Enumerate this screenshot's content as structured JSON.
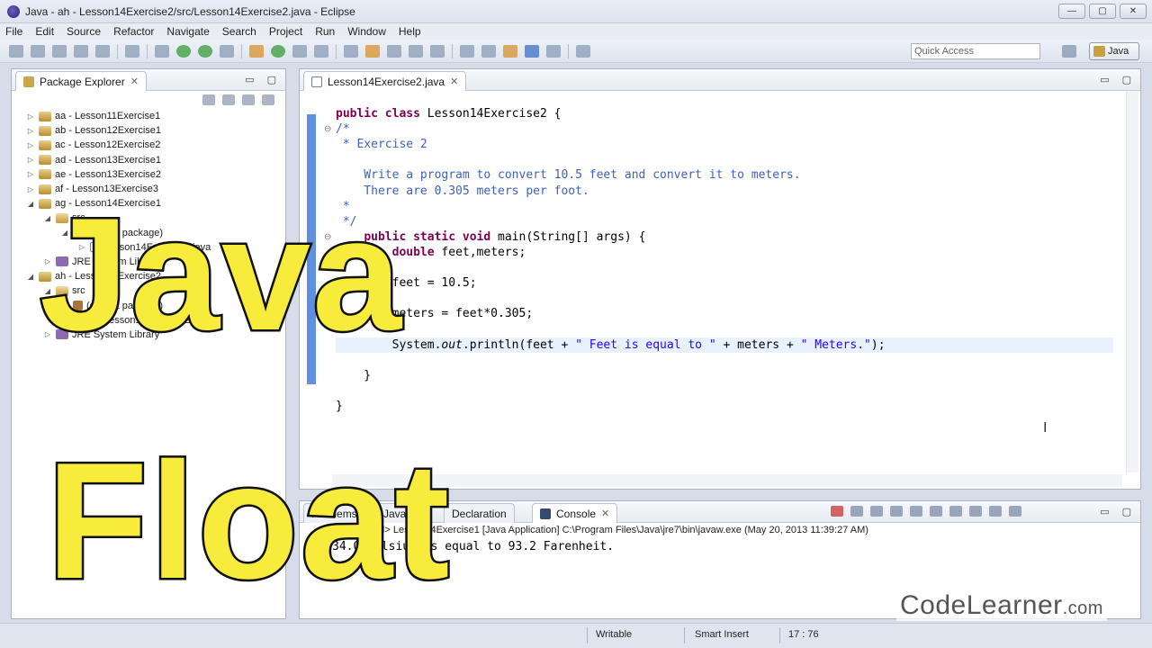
{
  "window": {
    "title": "Java - ah - Lesson14Exercise2/src/Lesson14Exercise2.java - Eclipse",
    "controls": [
      "—",
      "▢",
      "✕"
    ]
  },
  "menu": [
    "File",
    "Edit",
    "Source",
    "Refactor",
    "Navigate",
    "Search",
    "Project",
    "Run",
    "Window",
    "Help"
  ],
  "toolbar": {
    "quick_access_placeholder": "Quick Access",
    "perspective": "Java"
  },
  "package_explorer": {
    "tab_label": "Package Explorer",
    "tree": [
      {
        "label": "aa - Lesson11Exercise1",
        "indent": 0,
        "twisty": "▷",
        "icon": "proj"
      },
      {
        "label": "ab - Lesson12Exercise1",
        "indent": 0,
        "twisty": "▷",
        "icon": "proj"
      },
      {
        "label": "ac - Lesson12Exercise2",
        "indent": 0,
        "twisty": "▷",
        "icon": "proj"
      },
      {
        "label": "ad - Lesson13Exercise1",
        "indent": 0,
        "twisty": "▷",
        "icon": "proj"
      },
      {
        "label": "ae - Lesson13Exercise2",
        "indent": 0,
        "twisty": "▷",
        "icon": "proj"
      },
      {
        "label": "af - Lesson13Exercise3",
        "indent": 0,
        "twisty": "▷",
        "icon": "proj"
      },
      {
        "label": "ag - Lesson14Exercise1",
        "indent": 0,
        "twisty": "◢",
        "icon": "proj"
      },
      {
        "label": "src",
        "indent": 1,
        "twisty": "◢",
        "icon": "src"
      },
      {
        "label": "(default package)",
        "indent": 2,
        "twisty": "◢",
        "icon": "pkgi"
      },
      {
        "label": "Lesson14Exercise1.java",
        "indent": 3,
        "twisty": "▷",
        "icon": "java"
      },
      {
        "label": "JRE System Library",
        "indent": 1,
        "twisty": "▷",
        "icon": "lib"
      },
      {
        "label": "ah - Lesson14Exercise2",
        "indent": 0,
        "twisty": "◢",
        "icon": "proj"
      },
      {
        "label": "src",
        "indent": 1,
        "twisty": "◢",
        "icon": "src"
      },
      {
        "label": "(default package)",
        "indent": 2,
        "twisty": "◢",
        "icon": "pkgi"
      },
      {
        "label": "Lesson14Exercise2.java",
        "indent": 3,
        "twisty": "▷",
        "icon": "java"
      },
      {
        "label": "JRE System Library",
        "indent": 1,
        "twisty": "▷",
        "icon": "lib"
      }
    ]
  },
  "editor": {
    "tab_label": "Lesson14Exercise2.java",
    "lines": [
      {
        "html": "<span class='kw'>public class</span> Lesson14Exercise2 {"
      },
      {
        "html": "<span class='cm'>/*</span>",
        "fold": "⊖"
      },
      {
        "html": "<span class='cm'> * Exercise 2</span>"
      },
      {
        "html": ""
      },
      {
        "html": "<span class='cm'>    Write a program to convert 10.5 feet and convert it to meters.</span>"
      },
      {
        "html": "<span class='cm'>    There are 0.305 meters per foot.</span>"
      },
      {
        "html": "<span class='cm'> *</span>"
      },
      {
        "html": "<span class='cm'> */</span>"
      },
      {
        "html": "    <span class='kw'>public static void</span> main(String[] args) {",
        "fold": "⊖"
      },
      {
        "html": "        <span class='kw'>double</span> feet,meters;"
      },
      {
        "html": ""
      },
      {
        "html": "        feet = 10.5;"
      },
      {
        "html": ""
      },
      {
        "html": "        meters = feet*0.305;"
      },
      {
        "html": ""
      },
      {
        "html": "        System.<i>out</i>.println(feet + <span class='str'>\" Feet is equal to \"</span> + meters + <span class='str'>\" Meters.\"</span>);"
      },
      {
        "html": ""
      },
      {
        "html": "    }"
      },
      {
        "html": ""
      },
      {
        "html": "}"
      }
    ]
  },
  "console": {
    "tabs": [
      "Problems",
      "Javadoc",
      "Declaration",
      "Console"
    ],
    "active_tab": "Console",
    "terminated": "<terminated> Lesson14Exercise1 [Java Application] C:\\Program Files\\Java\\jre7\\bin\\javaw.exe (May 20, 2013 11:39:27 AM)",
    "output": "34.0 Celsius is equal to 93.2 Farenheit."
  },
  "status": {
    "writable": "Writable",
    "insert_mode": "Smart Insert",
    "position": "17 : 76"
  },
  "overlay": {
    "word1": "Java",
    "word2": "Float",
    "brand": "CodeLearner",
    "brand_suffix": ".com"
  }
}
